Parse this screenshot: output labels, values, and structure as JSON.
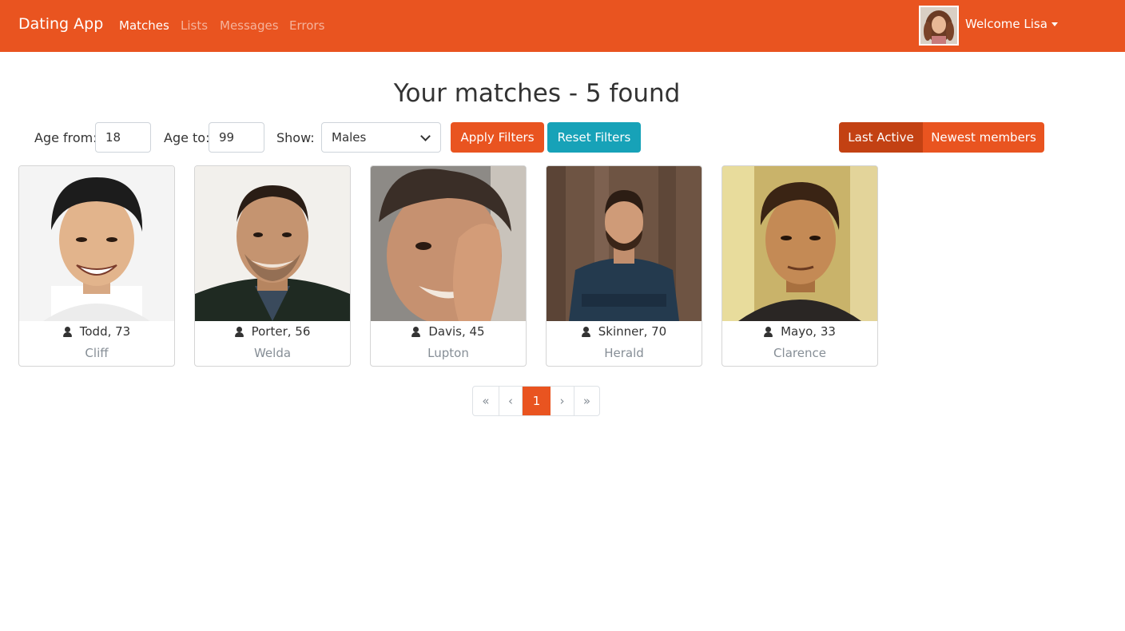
{
  "navbar": {
    "brand": "Dating App",
    "links": [
      "Matches",
      "Lists",
      "Messages",
      "Errors"
    ],
    "active_link": "Matches",
    "welcome": "Welcome Lisa",
    "accent_color": "#e95420"
  },
  "page_title": "Your matches - 5 found",
  "filters": {
    "age_from_label": "Age from:",
    "age_from_value": "18",
    "age_to_label": "Age to:",
    "age_to_value": "99",
    "show_label": "Show:",
    "show_value": "Males",
    "apply_label": "Apply Filters",
    "reset_label": "Reset Filters"
  },
  "order_by": {
    "last_active": "Last Active",
    "newest": "Newest members",
    "selected": "Last Active"
  },
  "members": [
    {
      "name": "Todd, 73",
      "city": "Cliff"
    },
    {
      "name": "Porter, 56",
      "city": "Welda"
    },
    {
      "name": "Davis, 45",
      "city": "Lupton"
    },
    {
      "name": "Skinner, 70",
      "city": "Herald"
    },
    {
      "name": "Mayo, 33",
      "city": "Clarence"
    }
  ],
  "pagination": {
    "first": "«",
    "prev": "‹",
    "current": "1",
    "next": "›",
    "last": "»"
  }
}
